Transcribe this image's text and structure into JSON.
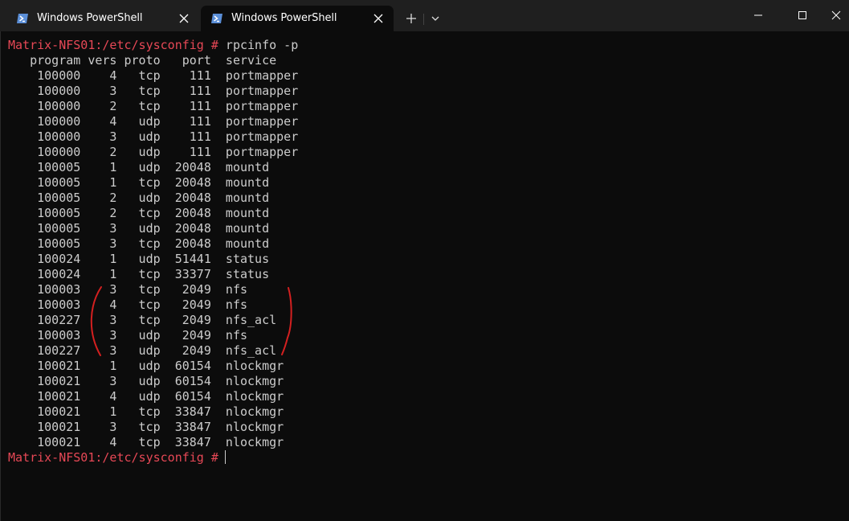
{
  "tabs": [
    {
      "label": "Windows PowerShell",
      "active": false
    },
    {
      "label": "Windows PowerShell",
      "active": true
    }
  ],
  "prompt": "Matrix-NFS01:/etc/sysconfig #",
  "command": " rpcinfo -p",
  "table": {
    "header": "   program vers proto   port  service",
    "rows": [
      {
        "program": "100000",
        "vers": "4",
        "proto": "tcp",
        "port": "111",
        "service": "portmapper"
      },
      {
        "program": "100000",
        "vers": "3",
        "proto": "tcp",
        "port": "111",
        "service": "portmapper"
      },
      {
        "program": "100000",
        "vers": "2",
        "proto": "tcp",
        "port": "111",
        "service": "portmapper"
      },
      {
        "program": "100000",
        "vers": "4",
        "proto": "udp",
        "port": "111",
        "service": "portmapper"
      },
      {
        "program": "100000",
        "vers": "3",
        "proto": "udp",
        "port": "111",
        "service": "portmapper"
      },
      {
        "program": "100000",
        "vers": "2",
        "proto": "udp",
        "port": "111",
        "service": "portmapper"
      },
      {
        "program": "100005",
        "vers": "1",
        "proto": "udp",
        "port": "20048",
        "service": "mountd"
      },
      {
        "program": "100005",
        "vers": "1",
        "proto": "tcp",
        "port": "20048",
        "service": "mountd"
      },
      {
        "program": "100005",
        "vers": "2",
        "proto": "udp",
        "port": "20048",
        "service": "mountd"
      },
      {
        "program": "100005",
        "vers": "2",
        "proto": "tcp",
        "port": "20048",
        "service": "mountd"
      },
      {
        "program": "100005",
        "vers": "3",
        "proto": "udp",
        "port": "20048",
        "service": "mountd"
      },
      {
        "program": "100005",
        "vers": "3",
        "proto": "tcp",
        "port": "20048",
        "service": "mountd"
      },
      {
        "program": "100024",
        "vers": "1",
        "proto": "udp",
        "port": "51441",
        "service": "status"
      },
      {
        "program": "100024",
        "vers": "1",
        "proto": "tcp",
        "port": "33377",
        "service": "status"
      },
      {
        "program": "100003",
        "vers": "3",
        "proto": "tcp",
        "port": "2049",
        "service": "nfs"
      },
      {
        "program": "100003",
        "vers": "4",
        "proto": "tcp",
        "port": "2049",
        "service": "nfs"
      },
      {
        "program": "100227",
        "vers": "3",
        "proto": "tcp",
        "port": "2049",
        "service": "nfs_acl"
      },
      {
        "program": "100003",
        "vers": "3",
        "proto": "udp",
        "port": "2049",
        "service": "nfs"
      },
      {
        "program": "100227",
        "vers": "3",
        "proto": "udp",
        "port": "2049",
        "service": "nfs_acl"
      },
      {
        "program": "100021",
        "vers": "1",
        "proto": "udp",
        "port": "60154",
        "service": "nlockmgr"
      },
      {
        "program": "100021",
        "vers": "3",
        "proto": "udp",
        "port": "60154",
        "service": "nlockmgr"
      },
      {
        "program": "100021",
        "vers": "4",
        "proto": "udp",
        "port": "60154",
        "service": "nlockmgr"
      },
      {
        "program": "100021",
        "vers": "1",
        "proto": "tcp",
        "port": "33847",
        "service": "nlockmgr"
      },
      {
        "program": "100021",
        "vers": "3",
        "proto": "tcp",
        "port": "33847",
        "service": "nlockmgr"
      },
      {
        "program": "100021",
        "vers": "4",
        "proto": "tcp",
        "port": "33847",
        "service": "nlockmgr"
      }
    ]
  },
  "colors": {
    "prompt": "#e74856",
    "text": "#cccccc",
    "background": "#0c0c0c",
    "titlebar": "#1f1f1f",
    "annotation": "#d42020"
  },
  "icons": {
    "tab": "powershell-icon",
    "tab_close": "close-icon",
    "new_tab": "plus-icon",
    "dropdown": "chevron-down-icon",
    "minimize": "minimize-icon",
    "maximize": "maximize-icon",
    "close": "window-close-icon"
  }
}
